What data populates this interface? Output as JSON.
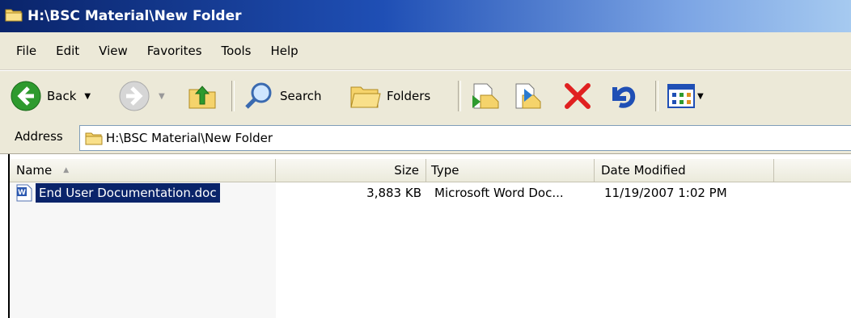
{
  "window": {
    "title": "H:\\BSC Material\\New Folder"
  },
  "menu": {
    "items": [
      "File",
      "Edit",
      "View",
      "Favorites",
      "Tools",
      "Help"
    ]
  },
  "toolbar": {
    "back_label": "Back",
    "search_label": "Search",
    "folders_label": "Folders"
  },
  "address": {
    "label": "Address",
    "value": "H:\\BSC Material\\New Folder"
  },
  "columns": {
    "name": "Name",
    "size": "Size",
    "type": "Type",
    "date": "Date Modified"
  },
  "files": [
    {
      "name": "End User Documentation.doc",
      "size": "3,883 KB",
      "type": "Microsoft Word Doc...",
      "date": "11/19/2007 1:02 PM"
    }
  ],
  "colors": {
    "title_bar": "#0a246a",
    "selection": "#0a246a",
    "back_green": "#2e9a2e",
    "delete_red": "#e02020"
  }
}
